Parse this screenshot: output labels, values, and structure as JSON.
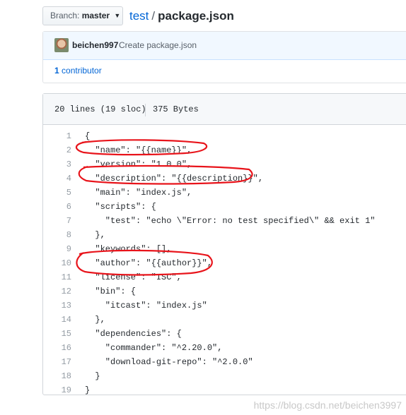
{
  "breadcrumb": {
    "branch_label": "Branch:",
    "branch_value": "master",
    "repo": "test",
    "separator": "/",
    "file": "package.json"
  },
  "commit": {
    "author": "beichen997",
    "message": "Create package.json",
    "contributors_count": "1",
    "contributors_label": "contributor"
  },
  "file": {
    "lines_info": "20 lines (19 sloc)",
    "size": "375 Bytes",
    "code": [
      {
        "n": "1",
        "text": "{"
      },
      {
        "n": "2",
        "text": "  \"name\": \"{{name}}\","
      },
      {
        "n": "3",
        "text": "  \"version\": \"1.0.0\","
      },
      {
        "n": "4",
        "text": "  \"description\": \"{{description}}\","
      },
      {
        "n": "5",
        "text": "  \"main\": \"index.js\","
      },
      {
        "n": "6",
        "text": "  \"scripts\": {"
      },
      {
        "n": "7",
        "text": "    \"test\": \"echo \\\"Error: no test specified\\\" && exit 1\""
      },
      {
        "n": "8",
        "text": "  },"
      },
      {
        "n": "9",
        "text": "  \"keywords\": [],"
      },
      {
        "n": "10",
        "text": "  \"author\": \"{{author}}\","
      },
      {
        "n": "11",
        "text": "  \"license\": \"ISC\","
      },
      {
        "n": "12",
        "text": "  \"bin\": {"
      },
      {
        "n": "13",
        "text": "    \"itcast\": \"index.js\""
      },
      {
        "n": "14",
        "text": "  },"
      },
      {
        "n": "15",
        "text": "  \"dependencies\": {"
      },
      {
        "n": "16",
        "text": "    \"commander\": \"^2.20.0\","
      },
      {
        "n": "17",
        "text": "    \"download-git-repo\": \"^2.0.0\""
      },
      {
        "n": "18",
        "text": "  }"
      },
      {
        "n": "19",
        "text": "}"
      }
    ]
  },
  "annotation_color": "#e8141b",
  "watermark": "https://blog.csdn.net/beichen3997"
}
